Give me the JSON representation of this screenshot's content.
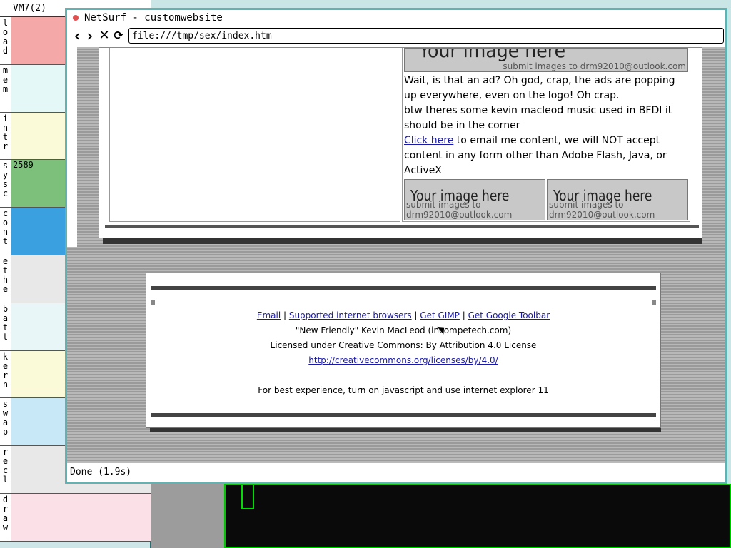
{
  "monitor": {
    "title": "VM7(2)",
    "rows": [
      {
        "label": "load",
        "color": "#f4a8a8",
        "value": ""
      },
      {
        "label": "mem",
        "color": "#e4f8f8",
        "value": ""
      },
      {
        "label": "intr",
        "color": "#fafad8",
        "value": ""
      },
      {
        "label": "sysc",
        "color": "#7cc07c",
        "value": "2589"
      },
      {
        "label": "cont",
        "color": "#3aa0e0",
        "value": ""
      },
      {
        "label": "ethe",
        "color": "#e8e8e8",
        "value": ""
      },
      {
        "label": "batt",
        "color": "#e8f6f8",
        "value": ""
      },
      {
        "label": "kern",
        "color": "#fafad8",
        "value": ""
      },
      {
        "label": "swap",
        "color": "#c8e8f8",
        "value": ""
      },
      {
        "label": "recl",
        "color": "#e8e8e8",
        "value": ""
      },
      {
        "label": "draw",
        "color": "#fce0e8",
        "value": ""
      }
    ]
  },
  "browser": {
    "title": "NetSurf - customwebsite",
    "url": "file:///tmp/sex/index.htm",
    "status": "Done (1.9s)",
    "nav": {
      "back": "‹",
      "forward": "›",
      "stop": "✕",
      "reload": "⟳"
    }
  },
  "page": {
    "ad_banner": {
      "big": "Your image here",
      "sub": "submit images to drm92010@outlook.com"
    },
    "text_line1": "Wait, is that an ad? Oh god, crap, the ads are popping up everywhere, even on the logo! Oh crap.",
    "text_line2": "btw theres some kevin macleod music used in BFDI it should be in the corner",
    "link_click_here": "Click here",
    "text_line3": " to email me content, we will NOT accept content in any form other than Adobe Flash, Java, or ActiveX",
    "ad_small": [
      {
        "big": "Your image here",
        "sub": "submit images to drm92010@outlook.com"
      },
      {
        "big": "Your image here",
        "sub": "submit images to drm92010@outlook.com"
      }
    ]
  },
  "footer": {
    "links": [
      "Email",
      "Supported internet browsers",
      "Get GIMP",
      "Get Google Toolbar"
    ],
    "separator": " | ",
    "credit": "\"New Friendly\" Kevin MacLeod (incompetech.com)",
    "license": "Licensed under Creative Commons: By Attribution 4.0 License",
    "license_url": "http://creativecommons.org/licenses/by/4.0/",
    "best_experience": "For best experience, turn on javascript and use internet explorer 11"
  }
}
